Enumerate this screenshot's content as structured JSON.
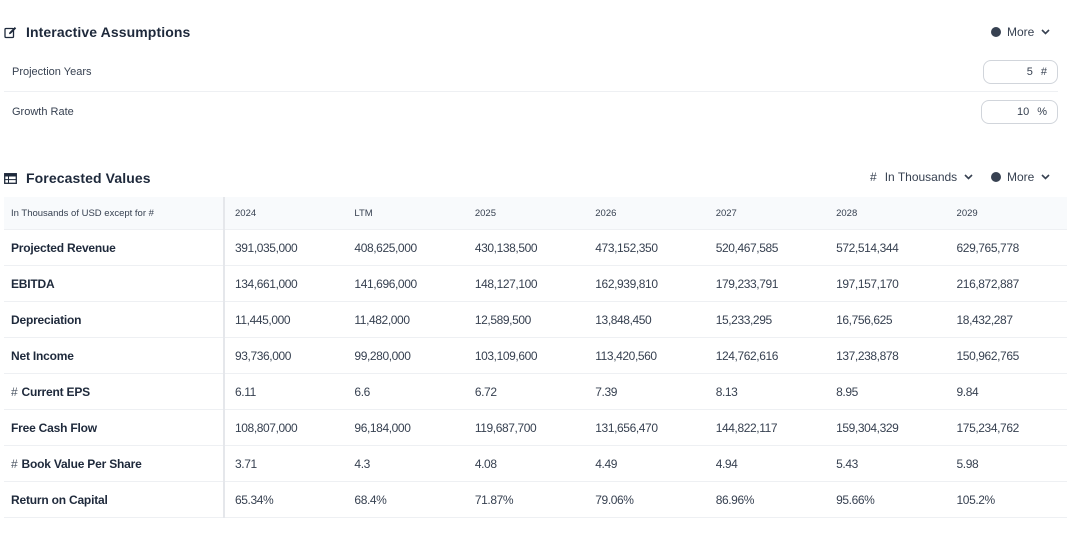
{
  "assumptions": {
    "title": "Interactive Assumptions",
    "more_label": "More",
    "fields": [
      {
        "label": "Projection Years",
        "value": "5",
        "unit": "#"
      },
      {
        "label": "Growth Rate",
        "value": "10",
        "unit": "%"
      }
    ]
  },
  "forecast": {
    "title": "Forecasted Values",
    "units_label": "In Thousands",
    "units_prefix": "#",
    "more_label": "More",
    "table": {
      "header_label": "In Thousands of USD except for #",
      "columns": [
        "2024",
        "LTM",
        "2025",
        "2026",
        "2027",
        "2028",
        "2029"
      ],
      "rows": [
        {
          "prefix": "",
          "label": "Projected Revenue",
          "values": [
            "391,035,000",
            "408,625,000",
            "430,138,500",
            "473,152,350",
            "520,467,585",
            "572,514,344",
            "629,765,778"
          ]
        },
        {
          "prefix": "",
          "label": "EBITDA",
          "values": [
            "134,661,000",
            "141,696,000",
            "148,127,100",
            "162,939,810",
            "179,233,791",
            "197,157,170",
            "216,872,887"
          ]
        },
        {
          "prefix": "",
          "label": "Depreciation",
          "values": [
            "11,445,000",
            "11,482,000",
            "12,589,500",
            "13,848,450",
            "15,233,295",
            "16,756,625",
            "18,432,287"
          ]
        },
        {
          "prefix": "",
          "label": "Net Income",
          "values": [
            "93,736,000",
            "99,280,000",
            "103,109,600",
            "113,420,560",
            "124,762,616",
            "137,238,878",
            "150,962,765"
          ]
        },
        {
          "prefix": "#",
          "label": "Current EPS",
          "values": [
            "6.11",
            "6.6",
            "6.72",
            "7.39",
            "8.13",
            "8.95",
            "9.84"
          ]
        },
        {
          "prefix": "",
          "label": "Free Cash Flow",
          "values": [
            "108,807,000",
            "96,184,000",
            "119,687,700",
            "131,656,470",
            "144,822,117",
            "159,304,329",
            "175,234,762"
          ]
        },
        {
          "prefix": "#",
          "label": "Book Value Per Share",
          "values": [
            "3.71",
            "4.3",
            "4.08",
            "4.49",
            "4.94",
            "5.43",
            "5.98"
          ]
        },
        {
          "prefix": "",
          "label": "Return on Capital",
          "values": [
            "65.34%",
            "68.4%",
            "71.87%",
            "79.06%",
            "86.96%",
            "95.66%",
            "105.2%"
          ]
        }
      ]
    }
  }
}
